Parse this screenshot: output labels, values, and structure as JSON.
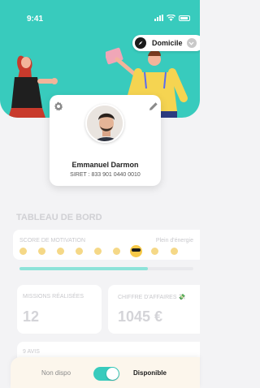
{
  "status_bar": {
    "time": "9:41"
  },
  "location": {
    "label": "Domicile"
  },
  "profile": {
    "name": "Emmanuel Darmon",
    "siret": "SIRET : 833 901 0440 0010"
  },
  "dashboard": {
    "title": "TABLEAU DE BORD",
    "motivation": {
      "label": "SCORE DE MOTIVATION",
      "level_label": "Plein d'énergie",
      "progress_fraction": 0.74
    },
    "missions": {
      "label": "MISSIONS RÉALISÉES",
      "value": "12"
    },
    "revenue": {
      "label": "CHIFFRE D'AFFAIRES 💸",
      "value": "1045 €"
    },
    "reviews": {
      "label": "9 AVIS"
    }
  },
  "availability": {
    "off_label": "Non dispo",
    "on_label": "Disponible",
    "is_available": true
  },
  "colors": {
    "brand": "#38cbbd",
    "star": "#f6cc54"
  }
}
